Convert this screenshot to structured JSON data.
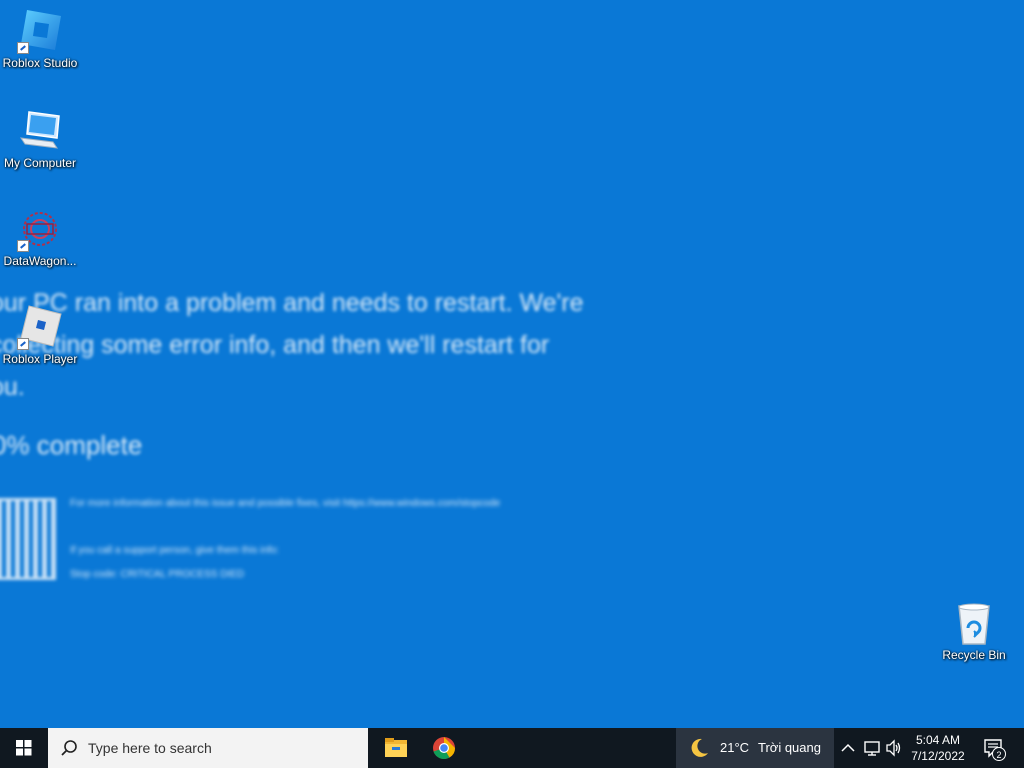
{
  "wallpaper": {
    "message": "our PC ran into a problem and needs to restart. We're\n collecting some error info, and then we'll restart for\nou.",
    "progress": "0% complete",
    "info_line": "For more information about this issue and possible fixes, visit https://www.windows.com/stopcode",
    "support_line": "If you call a support person, give them this info:",
    "stop_code": "Stop code: CRITICAL PROCESS DIED"
  },
  "desktop_icons": [
    {
      "label": "Roblox Studio",
      "icon": "roblox-studio-icon"
    },
    {
      "label": "My Computer",
      "icon": "computer-icon"
    },
    {
      "label": "DataWagon...",
      "icon": "datawagon-icon"
    },
    {
      "label": "Roblox Player",
      "icon": "roblox-player-icon"
    },
    {
      "label": "Recycle Bin",
      "icon": "recycle-bin-icon"
    }
  ],
  "taskbar": {
    "search_placeholder": "Type here to search",
    "weather_temp": "21°C",
    "weather_condition": "Trời quang",
    "time": "5:04 AM",
    "date": "7/12/2022",
    "notification_count": "2"
  },
  "colors": {
    "desktop_bg": "#0a78d6",
    "taskbar_bg": "#101820",
    "search_bg": "#f3f3f3"
  }
}
